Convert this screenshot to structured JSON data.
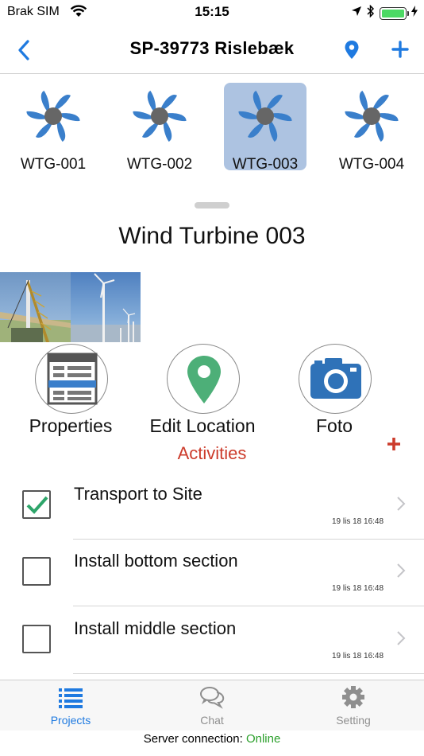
{
  "status_bar": {
    "carrier": "Brak SIM",
    "time": "15:15",
    "battery_level": 1.0
  },
  "nav": {
    "title": "SP-39773 Rislebæk",
    "back_icon": "chevron-left-icon",
    "location_icon": "map-pin-icon",
    "add_icon": "plus-icon",
    "accent_color": "#1f7ae0"
  },
  "turbines": [
    {
      "label": "WTG-001",
      "selected": false
    },
    {
      "label": "WTG-002",
      "selected": false
    },
    {
      "label": "WTG-003",
      "selected": true
    },
    {
      "label": "WTG-004",
      "selected": false
    }
  ],
  "detail": {
    "title": "Wind Turbine 003"
  },
  "actions": [
    {
      "label": "Properties",
      "icon": "properties-form-icon"
    },
    {
      "label": "Edit Location",
      "icon": "map-pin-icon"
    },
    {
      "label": "Foto",
      "icon": "camera-icon"
    }
  ],
  "activities": {
    "title": "Activities",
    "title_color": "#cc3b2b",
    "items": [
      {
        "title": "Transport to Site",
        "timestamp": "19 lis 18 16:48",
        "checked": true
      },
      {
        "title": "Install bottom section",
        "timestamp": "19 lis 18 16:48",
        "checked": false
      },
      {
        "title": "Install middle section",
        "timestamp": "19 lis 18 16:48",
        "checked": false
      }
    ]
  },
  "tabs": [
    {
      "label": "Projects",
      "icon": "list-icon",
      "active": true
    },
    {
      "label": "Chat",
      "icon": "chat-bubbles-icon",
      "active": false
    },
    {
      "label": "Setting",
      "icon": "gear-icon",
      "active": false
    }
  ],
  "server": {
    "label": "Server connection: ",
    "status": "Online",
    "status_color": "#2ca02c"
  }
}
